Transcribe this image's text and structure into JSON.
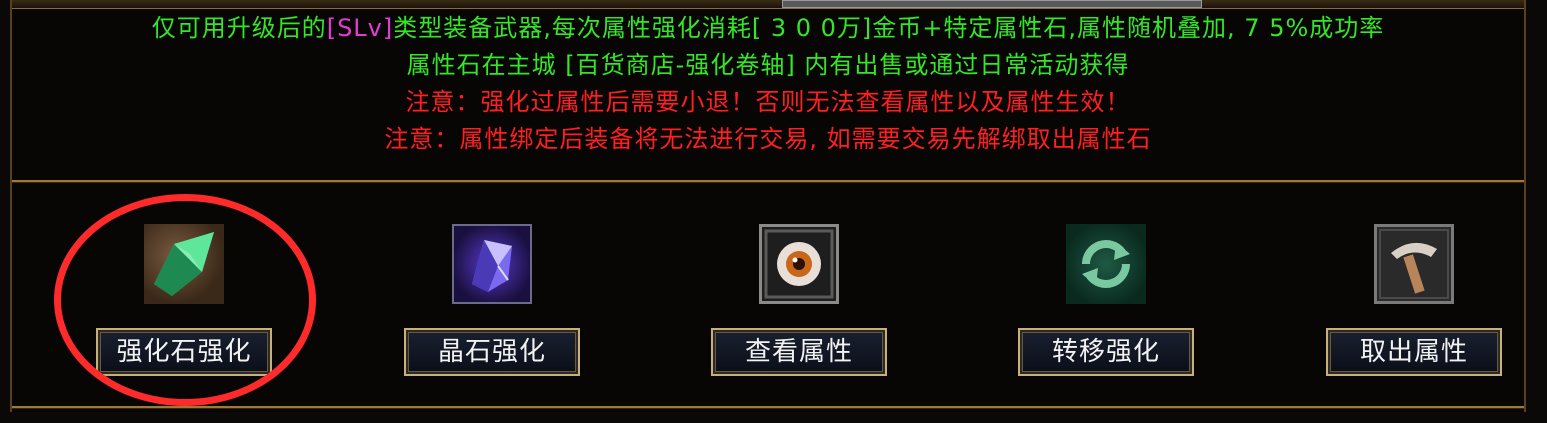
{
  "notice": {
    "line1_prefix": "仅可用升级后的",
    "line1_tag": "[SLv]",
    "line1_suffix": "类型装备武器,每次属性强化消耗[ 3 0 0万]金币+特定属性石,属性随机叠加, 7 5%成功率",
    "line2": "属性石在主城 [百货商店-强化卷轴] 内有出售或通过日常活动获得",
    "warning1": "注意：强化过属性后需要小退！否则无法查看属性以及属性生效！",
    "warning2": "注意：属性绑定后装备将无法进行交易, 如需要交易先解绑取出属性石"
  },
  "actions": [
    {
      "label": "强化石强化",
      "icon": "green-gem-icon"
    },
    {
      "label": "晶石强化",
      "icon": "purple-crystal-icon"
    },
    {
      "label": "查看属性",
      "icon": "eye-icon"
    },
    {
      "label": "转移强化",
      "icon": "cycle-arrows-icon"
    },
    {
      "label": "取出属性",
      "icon": "hammer-tool-icon"
    }
  ],
  "colors": {
    "info_text": "#33e626",
    "tag_text": "#e63ad6",
    "warning_text": "#ff1f1f",
    "highlight_circle": "#ff2a2a",
    "button_border": "#c9b077"
  }
}
